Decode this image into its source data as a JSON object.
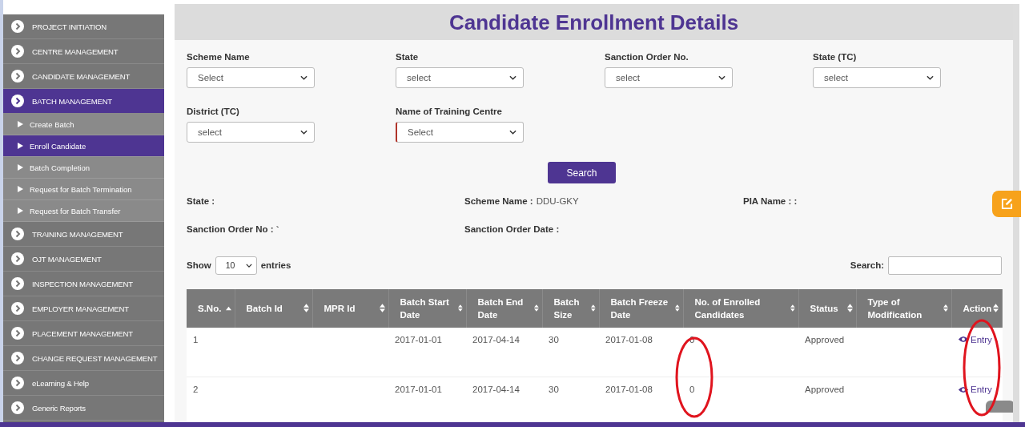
{
  "sidebar": {
    "items": [
      {
        "label": "PROJECT INITIATION",
        "selected": false
      },
      {
        "label": "CENTRE MANAGEMENT",
        "selected": false
      },
      {
        "label": "CANDIDATE MANAGEMENT",
        "selected": false
      },
      {
        "label": "BATCH MANAGEMENT",
        "selected": true,
        "children": [
          {
            "label": "Create Batch",
            "selected": false
          },
          {
            "label": "Enroll Candidate",
            "selected": true
          },
          {
            "label": "Batch Completion",
            "selected": false
          },
          {
            "label": "Request for Batch Termination",
            "selected": false
          },
          {
            "label": "Request for Batch Transfer",
            "selected": false
          }
        ]
      },
      {
        "label": "TRAINING MANAGEMENT",
        "selected": false
      },
      {
        "label": "OJT MANAGEMENT",
        "selected": false
      },
      {
        "label": "INSPECTION MANAGEMENT",
        "selected": false
      },
      {
        "label": "EMPLOYER MANAGEMENT",
        "selected": false
      },
      {
        "label": "PLACEMENT MANAGEMENT",
        "selected": false
      },
      {
        "label": "CHANGE REQUEST MANAGEMENT",
        "selected": false
      },
      {
        "label": "eLearning & Help",
        "selected": false
      },
      {
        "label": "Generic Reports",
        "selected": false
      }
    ]
  },
  "page_title": "Candidate Enrollment Details",
  "filters": [
    {
      "label": "Scheme Name",
      "value": "Select",
      "invalid": false
    },
    {
      "label": "State",
      "value": "select",
      "invalid": false
    },
    {
      "label": "Sanction Order No.",
      "value": "select",
      "invalid": false
    },
    {
      "label": "State (TC)",
      "value": "select",
      "invalid": false
    },
    {
      "label": "District (TC)",
      "value": "select",
      "invalid": false
    },
    {
      "label": "Name of Training Centre",
      "value": "Select",
      "invalid": true
    }
  ],
  "search_button": "Search",
  "info": [
    {
      "label": "State :"
    },
    {
      "label": "Scheme Name :",
      "value": "DDU-GKY"
    },
    {
      "label": "PIA Name : :"
    },
    {
      "label": "Sanction Order No : `"
    },
    {
      "label": "Sanction Order Date :"
    }
  ],
  "table": {
    "show_label": "Show",
    "page_size": "10",
    "entries_label": "entries",
    "search_label": "Search:",
    "columns": [
      {
        "label": "S.No.",
        "sorted": true
      },
      {
        "label": "Batch Id",
        "sorted": false
      },
      {
        "label": "MPR Id",
        "sorted": false
      },
      {
        "label": "Batch Start Date",
        "sorted": false
      },
      {
        "label": "Batch End Date",
        "sorted": false
      },
      {
        "label": "Batch Size",
        "sorted": false
      },
      {
        "label": "Batch Freeze Date",
        "sorted": false
      },
      {
        "label": "No. of Enrolled Candidates",
        "sorted": false
      },
      {
        "label": "Status",
        "sorted": false
      },
      {
        "label": "Type of Modification",
        "sorted": false
      },
      {
        "label": "Action",
        "sorted": false
      }
    ],
    "rows": [
      {
        "s_no": "1",
        "batch_start_date": "2017-01-01",
        "batch_end_date": "2017-04-14",
        "batch_size": "30",
        "batch_freeze_date": "2017-01-08",
        "enrolled": "0",
        "status": "Approved",
        "action": "Entry"
      },
      {
        "s_no": "2",
        "batch_start_date": "2017-01-01",
        "batch_end_date": "2017-04-14",
        "batch_size": "30",
        "batch_freeze_date": "2017-01-08",
        "enrolled": "0",
        "status": "Approved",
        "action": "Entry"
      }
    ]
  },
  "annotations": [
    {
      "kind": "ellipse"
    },
    {
      "kind": "ellipse"
    }
  ]
}
